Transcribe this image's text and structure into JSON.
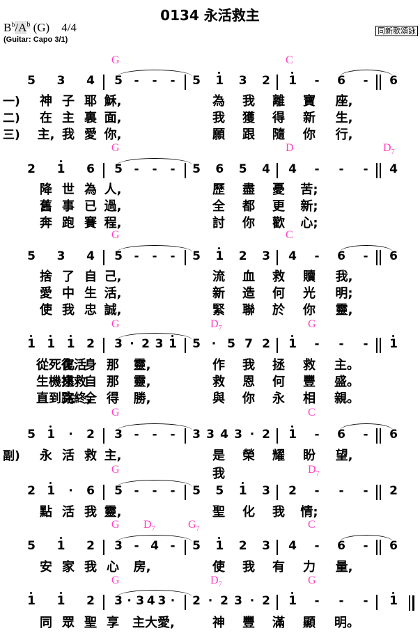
{
  "hymn": {
    "title": "0134 永活救主",
    "source": "同新歌頌詠",
    "key_parts": {
      "main": "B",
      "flat1": "b",
      "slash": "/A",
      "flat2": "b",
      "tail": " (G)    4/4"
    },
    "capo": "(Guitar: Capo 3/1)"
  },
  "accent_colors": {
    "chord": "#ff3fbf"
  },
  "systems": [
    {
      "chords": [
        {
          "text": "G",
          "sub": ""
        },
        {
          "text": "C",
          "sub": ""
        }
      ],
      "notes": [
        "5",
        "3",
        "4",
        "|",
        "5",
        "-",
        "-",
        "-",
        "|",
        "5",
        "i",
        "3",
        "2",
        "|",
        "i",
        "-",
        "6",
        "-",
        "|",
        "6"
      ],
      "verses": [
        {
          "label": "一)",
          "text": [
            "神",
            "子",
            "耶",
            "穌,",
            "",
            "為",
            "我",
            "離",
            "寶",
            "座,"
          ]
        },
        {
          "label": "二)",
          "text": [
            "在",
            "主",
            "裏",
            "面,",
            "",
            "我",
            "獲",
            "得",
            "新",
            "生,"
          ]
        },
        {
          "label": "三)",
          "text": [
            "主,",
            "我",
            "愛",
            "你,",
            "",
            "願",
            "跟",
            "隨",
            "你",
            "行,"
          ]
        }
      ]
    },
    {
      "chords": [
        {
          "text": "G",
          "sub": ""
        },
        {
          "text": "D",
          "sub": ""
        },
        {
          "text": "D",
          "sub": "7"
        }
      ],
      "notes": [
        "2",
        "i",
        "6",
        "|",
        "5",
        "-",
        "-",
        "-",
        "|",
        "5",
        "6",
        "5",
        "4",
        "|",
        "4",
        "-",
        "-",
        "-",
        "|",
        "4"
      ],
      "verses": [
        {
          "label": "",
          "text": [
            "降",
            "世",
            "為",
            "人,",
            "",
            "歷",
            "盡",
            "憂",
            "苦;",
            ""
          ]
        },
        {
          "label": "",
          "text": [
            "舊",
            "事",
            "已",
            "過,",
            "",
            "全",
            "都",
            "更",
            "新;",
            ""
          ]
        },
        {
          "label": "",
          "text": [
            "奔",
            "跑",
            "賽",
            "程,",
            "",
            "討",
            "你",
            "歡",
            "心;",
            ""
          ]
        }
      ]
    },
    {
      "chords": [
        {
          "text": "G",
          "sub": ""
        },
        {
          "text": "C",
          "sub": ""
        }
      ],
      "notes": [
        "5",
        "3",
        "4",
        "|",
        "5",
        "-",
        "-",
        "-",
        "|",
        "5",
        "i",
        "2",
        "3",
        "|",
        "4",
        "-",
        "6",
        "-",
        "|",
        "6"
      ],
      "verses": [
        {
          "label": "",
          "text": [
            "捨",
            "了",
            "自",
            "己,",
            "",
            "流",
            "血",
            "救",
            "贖",
            "我,"
          ]
        },
        {
          "label": "",
          "text": [
            "愛",
            "中",
            "生",
            "活,",
            "",
            "新",
            "造",
            "何",
            "光",
            "明;"
          ]
        },
        {
          "label": "",
          "text": [
            "使",
            "我",
            "忠",
            "誠,",
            "",
            "緊",
            "聯",
            "於",
            "你",
            "靈,"
          ]
        }
      ]
    },
    {
      "chords": [
        {
          "text": "G",
          "sub": ""
        },
        {
          "text": "D",
          "sub": "7"
        },
        {
          "text": "G",
          "sub": ""
        }
      ],
      "notes": [
        "i",
        "i",
        "i",
        "2",
        "|",
        "3",
        "·",
        "2",
        "3",
        "i",
        "|",
        "5",
        "·",
        "5",
        "7",
        "2",
        "|",
        "i",
        "-",
        "-",
        "-",
        "|",
        "i"
      ],
      "verses": [
        {
          "label": "",
          "text": [
            "從死復活",
            "化",
            "身",
            "那",
            "靈,",
            "作",
            "我",
            "拯",
            "救",
            "主。"
          ]
        },
        {
          "label": "",
          "text": [
            "生機拯救",
            "來",
            "自",
            "那",
            "靈,",
            "救",
            "恩",
            "何",
            "豐",
            "盛。"
          ]
        },
        {
          "label": "",
          "text": [
            "直到路終,",
            "完",
            "全",
            "得",
            "勝,",
            "與",
            "你",
            "永",
            "相",
            "親。"
          ]
        }
      ]
    },
    {
      "chords": [
        {
          "text": "G",
          "sub": ""
        },
        {
          "text": "C",
          "sub": ""
        }
      ],
      "notes": [
        "5",
        "i",
        "·",
        "2",
        "|",
        "3",
        "-",
        "-",
        "-",
        "|",
        "3",
        "3",
        "4",
        "3",
        "·",
        "2",
        "|",
        "i",
        "-",
        "6",
        "-",
        "|",
        "6"
      ],
      "verses": [
        {
          "label": "副)",
          "text": [
            "永",
            "活",
            "救",
            "主,",
            "",
            "是我",
            "榮",
            "耀",
            "盼",
            "望,"
          ]
        }
      ]
    },
    {
      "chords": [
        {
          "text": "G",
          "sub": ""
        },
        {
          "text": "D",
          "sub": "7"
        }
      ],
      "notes": [
        "2",
        "i",
        "·",
        "6",
        "|",
        "5",
        "-",
        "-",
        "-",
        "|",
        "5",
        "5",
        "i",
        "3",
        "|",
        "2",
        "-",
        "-",
        "-",
        "|",
        "2"
      ],
      "verses": [
        {
          "label": "",
          "text": [
            "點",
            "活",
            "我",
            "靈,",
            "",
            "聖",
            "化",
            "我",
            "情;",
            ""
          ]
        }
      ]
    },
    {
      "chords": [
        {
          "text": "G",
          "sub": ""
        },
        {
          "text": "D",
          "sub": "7"
        },
        {
          "text": "G",
          "sub": "7"
        },
        {
          "text": "C",
          "sub": ""
        }
      ],
      "notes": [
        "5",
        "i",
        "2",
        "|",
        "3",
        "-",
        "4",
        "-",
        "|",
        "5",
        "i",
        "2",
        "3",
        "|",
        "4",
        "-",
        "6",
        "-",
        "|",
        "6"
      ],
      "verses": [
        {
          "label": "",
          "text": [
            "安",
            "家",
            "我",
            "心",
            "房,",
            "使",
            "我",
            "有",
            "力",
            "量,"
          ]
        }
      ]
    },
    {
      "chords": [
        {
          "text": "G",
          "sub": ""
        },
        {
          "text": "D",
          "sub": "7"
        },
        {
          "text": "G",
          "sub": ""
        }
      ],
      "notes": [
        "i",
        "i",
        "2",
        "|",
        "3",
        "·",
        "3",
        "4",
        "3",
        "·",
        "|",
        "2",
        "·",
        "2",
        "3",
        "·",
        "2",
        "|",
        "i",
        "-",
        "-",
        "-",
        "|",
        "i",
        "‖"
      ],
      "verses": [
        {
          "label": "",
          "text": [
            "同",
            "眾",
            "聖",
            "享",
            "主大愛,",
            "神",
            "豐",
            "滿",
            "顯",
            "明。"
          ]
        }
      ]
    }
  ]
}
